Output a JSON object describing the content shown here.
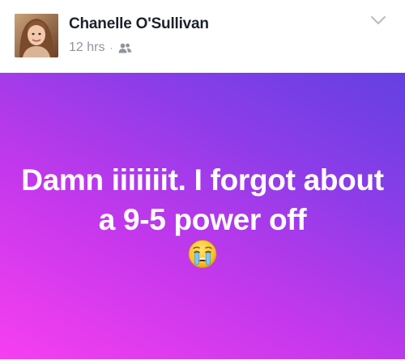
{
  "post": {
    "author": "Chanelle O'Sullivan",
    "timestamp": "12 hrs",
    "separator": "·",
    "audience_icon": "friends-icon",
    "options_icon": "chevron-down-icon",
    "text": "Damn iiiiiiit. I forgot about a 9-5 power off",
    "emoji_icon": "crying-face-emoji-icon",
    "background_gradient": [
      "#f63ff0",
      "#c538ec",
      "#8a3de8",
      "#6340e2"
    ]
  },
  "colors": {
    "name": "#1d2129",
    "meta": "#90949c",
    "post_text": "#ffffff"
  }
}
